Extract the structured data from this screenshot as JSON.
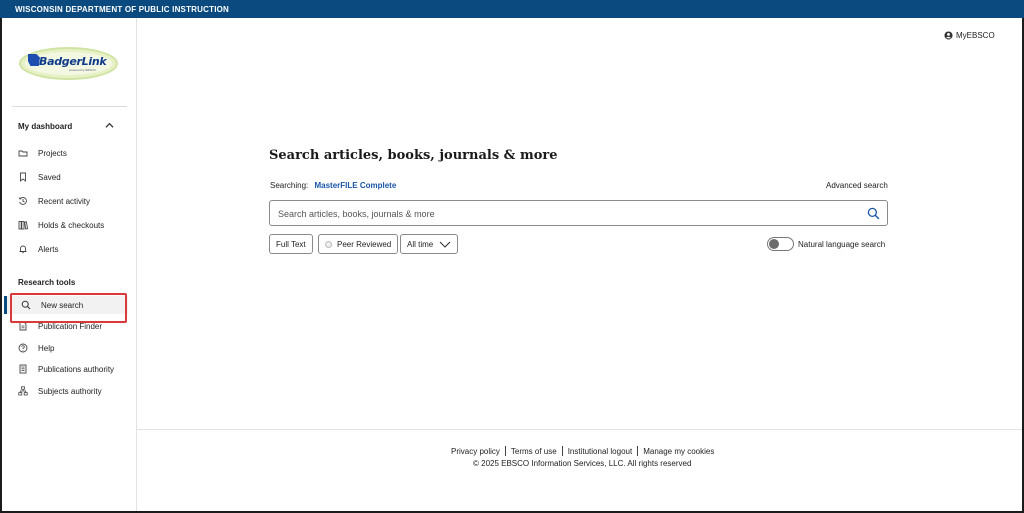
{
  "topbar": {
    "title": "WISCONSIN DEPARTMENT OF PUBLIC INSTRUCTION"
  },
  "logo": {
    "text": "BadgerLink",
    "subtext": "powered by EBSCO"
  },
  "sidebar": {
    "dashboard_heading": "My dashboard",
    "dashboard_items": [
      {
        "label": "Projects",
        "icon": "folder-icon"
      },
      {
        "label": "Saved",
        "icon": "bookmark-icon"
      },
      {
        "label": "Recent activity",
        "icon": "history-icon"
      },
      {
        "label": "Holds & checkouts",
        "icon": "books-icon"
      },
      {
        "label": "Alerts",
        "icon": "bell-icon"
      }
    ],
    "research_heading": "Research tools",
    "research_items": [
      {
        "label": "New search",
        "icon": "search-icon",
        "active": true
      },
      {
        "label": "Publication Finder",
        "icon": "document-icon"
      },
      {
        "label": "Help",
        "icon": "help-icon"
      },
      {
        "label": "Publications authority",
        "icon": "publication-icon"
      },
      {
        "label": "Subjects authority",
        "icon": "hierarchy-icon"
      }
    ]
  },
  "header": {
    "account_label": "MyEBSCO"
  },
  "main": {
    "title": "Search articles, books, journals & more",
    "searching_label": "Searching:",
    "database": "MasterFILE Complete",
    "advanced_search": "Advanced search",
    "search_placeholder": "Search articles, books, journals & more",
    "filters": {
      "full_text": "Full Text",
      "peer_reviewed": "Peer Reviewed",
      "date_range": "All time"
    },
    "natural_language_label": "Natural language search",
    "natural_language_enabled": false
  },
  "footer": {
    "links": [
      "Privacy policy",
      "Terms of use",
      "Institutional logout",
      "Manage my cookies"
    ],
    "copyright": "© 2025 EBSCO Information Services, LLC. All rights reserved"
  },
  "colors": {
    "topbar": "#0a4a7e",
    "link": "#1a56a8",
    "highlight": "#d9393b"
  }
}
